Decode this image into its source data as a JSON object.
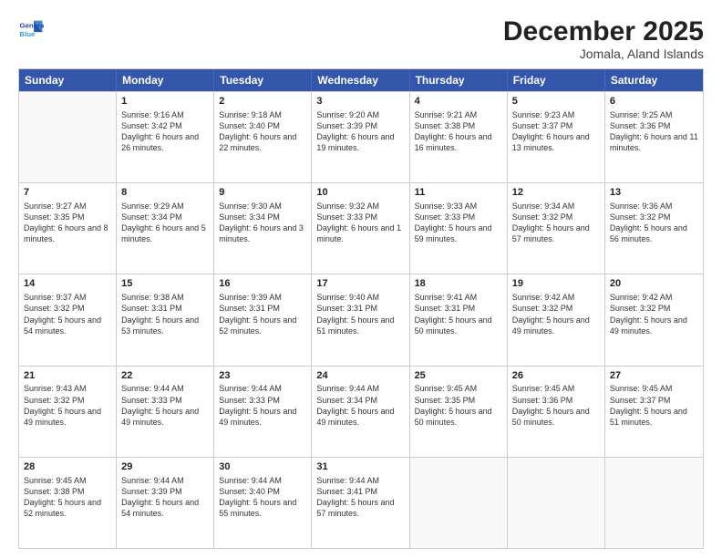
{
  "logo": {
    "line1": "General",
    "line2": "Blue"
  },
  "title": "December 2025",
  "subtitle": "Jomala, Aland Islands",
  "header_days": [
    "Sunday",
    "Monday",
    "Tuesday",
    "Wednesday",
    "Thursday",
    "Friday",
    "Saturday"
  ],
  "weeks": [
    [
      {
        "day": "",
        "sunrise": "",
        "sunset": "",
        "daylight": ""
      },
      {
        "day": "1",
        "sunrise": "Sunrise: 9:16 AM",
        "sunset": "Sunset: 3:42 PM",
        "daylight": "Daylight: 6 hours and 26 minutes."
      },
      {
        "day": "2",
        "sunrise": "Sunrise: 9:18 AM",
        "sunset": "Sunset: 3:40 PM",
        "daylight": "Daylight: 6 hours and 22 minutes."
      },
      {
        "day": "3",
        "sunrise": "Sunrise: 9:20 AM",
        "sunset": "Sunset: 3:39 PM",
        "daylight": "Daylight: 6 hours and 19 minutes."
      },
      {
        "day": "4",
        "sunrise": "Sunrise: 9:21 AM",
        "sunset": "Sunset: 3:38 PM",
        "daylight": "Daylight: 6 hours and 16 minutes."
      },
      {
        "day": "5",
        "sunrise": "Sunrise: 9:23 AM",
        "sunset": "Sunset: 3:37 PM",
        "daylight": "Daylight: 6 hours and 13 minutes."
      },
      {
        "day": "6",
        "sunrise": "Sunrise: 9:25 AM",
        "sunset": "Sunset: 3:36 PM",
        "daylight": "Daylight: 6 hours and 11 minutes."
      }
    ],
    [
      {
        "day": "7",
        "sunrise": "Sunrise: 9:27 AM",
        "sunset": "Sunset: 3:35 PM",
        "daylight": "Daylight: 6 hours and 8 minutes."
      },
      {
        "day": "8",
        "sunrise": "Sunrise: 9:29 AM",
        "sunset": "Sunset: 3:34 PM",
        "daylight": "Daylight: 6 hours and 5 minutes."
      },
      {
        "day": "9",
        "sunrise": "Sunrise: 9:30 AM",
        "sunset": "Sunset: 3:34 PM",
        "daylight": "Daylight: 6 hours and 3 minutes."
      },
      {
        "day": "10",
        "sunrise": "Sunrise: 9:32 AM",
        "sunset": "Sunset: 3:33 PM",
        "daylight": "Daylight: 6 hours and 1 minute."
      },
      {
        "day": "11",
        "sunrise": "Sunrise: 9:33 AM",
        "sunset": "Sunset: 3:33 PM",
        "daylight": "Daylight: 5 hours and 59 minutes."
      },
      {
        "day": "12",
        "sunrise": "Sunrise: 9:34 AM",
        "sunset": "Sunset: 3:32 PM",
        "daylight": "Daylight: 5 hours and 57 minutes."
      },
      {
        "day": "13",
        "sunrise": "Sunrise: 9:36 AM",
        "sunset": "Sunset: 3:32 PM",
        "daylight": "Daylight: 5 hours and 56 minutes."
      }
    ],
    [
      {
        "day": "14",
        "sunrise": "Sunrise: 9:37 AM",
        "sunset": "Sunset: 3:32 PM",
        "daylight": "Daylight: 5 hours and 54 minutes."
      },
      {
        "day": "15",
        "sunrise": "Sunrise: 9:38 AM",
        "sunset": "Sunset: 3:31 PM",
        "daylight": "Daylight: 5 hours and 53 minutes."
      },
      {
        "day": "16",
        "sunrise": "Sunrise: 9:39 AM",
        "sunset": "Sunset: 3:31 PM",
        "daylight": "Daylight: 5 hours and 52 minutes."
      },
      {
        "day": "17",
        "sunrise": "Sunrise: 9:40 AM",
        "sunset": "Sunset: 3:31 PM",
        "daylight": "Daylight: 5 hours and 51 minutes."
      },
      {
        "day": "18",
        "sunrise": "Sunrise: 9:41 AM",
        "sunset": "Sunset: 3:31 PM",
        "daylight": "Daylight: 5 hours and 50 minutes."
      },
      {
        "day": "19",
        "sunrise": "Sunrise: 9:42 AM",
        "sunset": "Sunset: 3:32 PM",
        "daylight": "Daylight: 5 hours and 49 minutes."
      },
      {
        "day": "20",
        "sunrise": "Sunrise: 9:42 AM",
        "sunset": "Sunset: 3:32 PM",
        "daylight": "Daylight: 5 hours and 49 minutes."
      }
    ],
    [
      {
        "day": "21",
        "sunrise": "Sunrise: 9:43 AM",
        "sunset": "Sunset: 3:32 PM",
        "daylight": "Daylight: 5 hours and 49 minutes."
      },
      {
        "day": "22",
        "sunrise": "Sunrise: 9:44 AM",
        "sunset": "Sunset: 3:33 PM",
        "daylight": "Daylight: 5 hours and 49 minutes."
      },
      {
        "day": "23",
        "sunrise": "Sunrise: 9:44 AM",
        "sunset": "Sunset: 3:33 PM",
        "daylight": "Daylight: 5 hours and 49 minutes."
      },
      {
        "day": "24",
        "sunrise": "Sunrise: 9:44 AM",
        "sunset": "Sunset: 3:34 PM",
        "daylight": "Daylight: 5 hours and 49 minutes."
      },
      {
        "day": "25",
        "sunrise": "Sunrise: 9:45 AM",
        "sunset": "Sunset: 3:35 PM",
        "daylight": "Daylight: 5 hours and 50 minutes."
      },
      {
        "day": "26",
        "sunrise": "Sunrise: 9:45 AM",
        "sunset": "Sunset: 3:36 PM",
        "daylight": "Daylight: 5 hours and 50 minutes."
      },
      {
        "day": "27",
        "sunrise": "Sunrise: 9:45 AM",
        "sunset": "Sunset: 3:37 PM",
        "daylight": "Daylight: 5 hours and 51 minutes."
      }
    ],
    [
      {
        "day": "28",
        "sunrise": "Sunrise: 9:45 AM",
        "sunset": "Sunset: 3:38 PM",
        "daylight": "Daylight: 5 hours and 52 minutes."
      },
      {
        "day": "29",
        "sunrise": "Sunrise: 9:44 AM",
        "sunset": "Sunset: 3:39 PM",
        "daylight": "Daylight: 5 hours and 54 minutes."
      },
      {
        "day": "30",
        "sunrise": "Sunrise: 9:44 AM",
        "sunset": "Sunset: 3:40 PM",
        "daylight": "Daylight: 5 hours and 55 minutes."
      },
      {
        "day": "31",
        "sunrise": "Sunrise: 9:44 AM",
        "sunset": "Sunset: 3:41 PM",
        "daylight": "Daylight: 5 hours and 57 minutes."
      },
      {
        "day": "",
        "sunrise": "",
        "sunset": "",
        "daylight": ""
      },
      {
        "day": "",
        "sunrise": "",
        "sunset": "",
        "daylight": ""
      },
      {
        "day": "",
        "sunrise": "",
        "sunset": "",
        "daylight": ""
      }
    ]
  ]
}
